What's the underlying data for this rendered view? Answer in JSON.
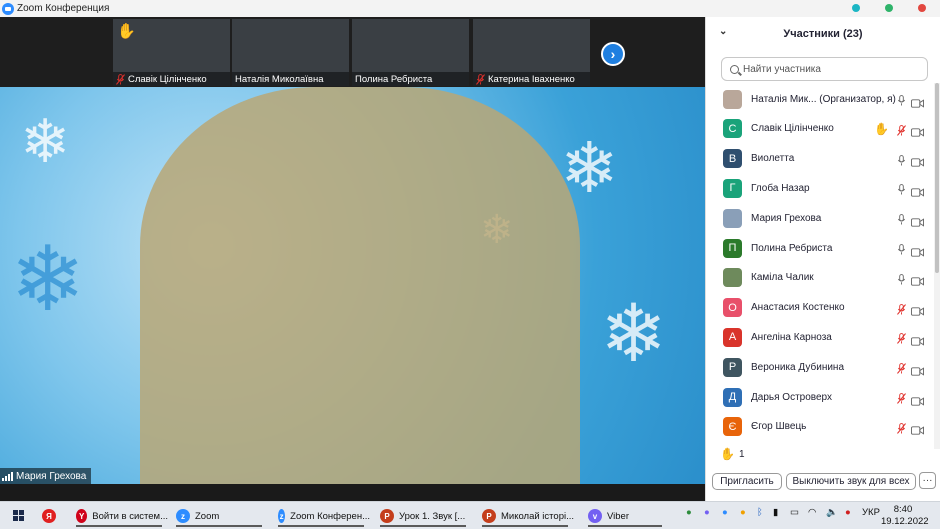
{
  "window": {
    "title": "Zoom Конференция",
    "controls": [
      {
        "name": "minimize",
        "color": "#1bb6c4"
      },
      {
        "name": "maximize",
        "color": "#2fb36a"
      },
      {
        "name": "close",
        "color": "#e2473f"
      }
    ]
  },
  "thumbnails": [
    {
      "name": "Славік Цілінченко",
      "muted": true,
      "hand_raised": true
    },
    {
      "name": "Наталія Миколаївна",
      "muted": false,
      "hand_raised": false
    },
    {
      "name": "Полина Ребриста",
      "muted": false,
      "hand_raised": false
    },
    {
      "name": "Катерина Івахненко",
      "muted": true,
      "hand_raised": false
    }
  ],
  "main_speaker": {
    "name": "Мария Грехова"
  },
  "participants_panel": {
    "title": "Участники (23)",
    "search_placeholder": "Найти участника",
    "participants": [
      {
        "name": "Наталія Мик... (Организатор, я)",
        "initial": "",
        "avatar_color": "#b9a79a",
        "photo": true,
        "mic": "on",
        "hand": false
      },
      {
        "name": "Славік Цілінченко",
        "initial": "С",
        "avatar_color": "#1aa37a",
        "photo": false,
        "mic": "off",
        "hand": true
      },
      {
        "name": "Виолетта",
        "initial": "В",
        "avatar_color": "#2f4f6f",
        "photo": false,
        "mic": "on",
        "hand": false
      },
      {
        "name": "Глоба Назар",
        "initial": "Г",
        "avatar_color": "#1aa37a",
        "photo": false,
        "mic": "on",
        "hand": false
      },
      {
        "name": "Мария Грехова",
        "initial": "",
        "avatar_color": "#8a9fb8",
        "photo": true,
        "mic": "on",
        "hand": false
      },
      {
        "name": "Полина Ребриста",
        "initial": "П",
        "avatar_color": "#2b7a2b",
        "photo": false,
        "mic": "on",
        "hand": false
      },
      {
        "name": "Каміла Чалик",
        "initial": "",
        "avatar_color": "#6e8a5c",
        "photo": true,
        "mic": "on",
        "hand": false
      },
      {
        "name": "Анастасия Костенко",
        "initial": "О",
        "avatar_color": "#e8506a",
        "photo": false,
        "mic": "off",
        "hand": false
      },
      {
        "name": "Ангеліна Карноза",
        "initial": "А",
        "avatar_color": "#d9342b",
        "photo": false,
        "mic": "off",
        "hand": false
      },
      {
        "name": "Вероника Дубинина",
        "initial": "Р",
        "avatar_color": "#3f5560",
        "photo": false,
        "mic": "off",
        "hand": false
      },
      {
        "name": "Дарья Островерх",
        "initial": "Д",
        "avatar_color": "#2f6fb5",
        "photo": false,
        "mic": "off",
        "hand": false
      },
      {
        "name": "Єгор Швець",
        "initial": "Є",
        "avatar_color": "#e8640a",
        "photo": false,
        "mic": "off",
        "hand": false
      }
    ],
    "raised_hands_count": "1",
    "invite_label": "Пригласить",
    "mute_all_label": "Выключить звук для всех",
    "more_label": "···"
  },
  "taskbar": {
    "items": [
      {
        "label": "",
        "icon": "yandex-icon",
        "color": "#e02020",
        "glyph": "Я"
      },
      {
        "label": "Войти в систем...",
        "icon": "yandex-browser-icon",
        "color": "#d0021b",
        "glyph": "Y"
      },
      {
        "label": "Zoom",
        "icon": "zoom-icon",
        "color": "#2d8cff",
        "glyph": "z"
      },
      {
        "label": "Zoom Конферен...",
        "icon": "zoom-meeting-icon",
        "color": "#2d8cff",
        "glyph": "z"
      },
      {
        "label": "Урок 1. Звук [...",
        "icon": "powerpoint-icon",
        "color": "#c43e1c",
        "glyph": "P"
      },
      {
        "label": "Миколай історі...",
        "icon": "powerpoint-icon",
        "color": "#c43e1c",
        "glyph": "P"
      },
      {
        "label": "Viber",
        "icon": "viber-icon",
        "color": "#7360f2",
        "glyph": "v"
      }
    ],
    "language": "УКР",
    "time": "8:40",
    "date": "19.12.2022"
  }
}
